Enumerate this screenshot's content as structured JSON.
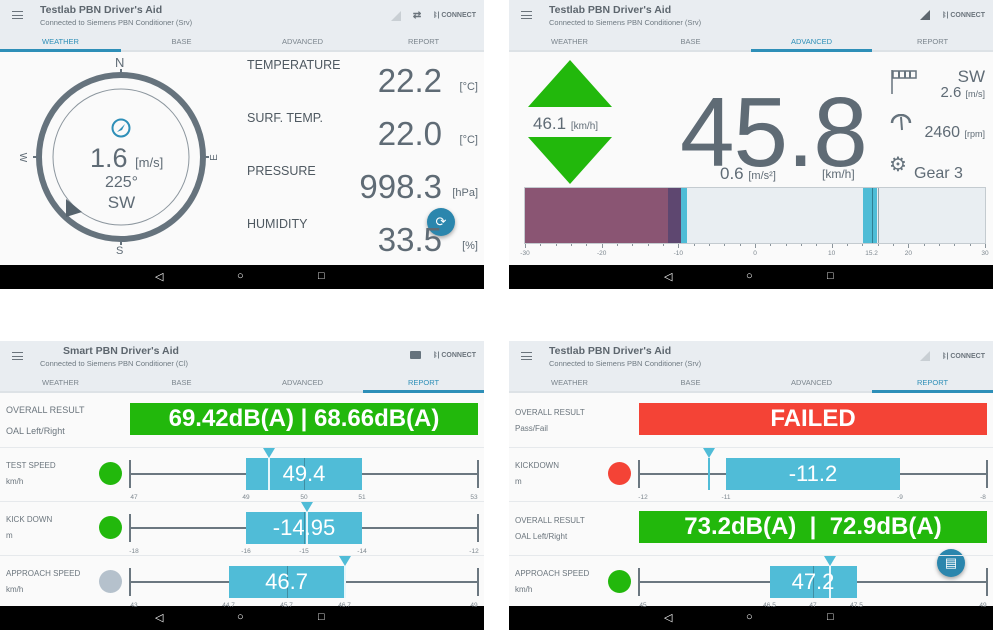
{
  "colors": {
    "accent": "#2e8fb8",
    "green": "#22b80c",
    "red": "#f44336",
    "cyan": "#50bcd7",
    "grey_dot": "#b5c1cc"
  },
  "tabs": [
    "WEATHER",
    "BASE",
    "ADVANCED",
    "REPORT"
  ],
  "connect_label": "CONNECT",
  "panels": [
    {
      "title": "Testlab PBN Driver's Aid",
      "subtitle": "Connected to Siemens PBN Conditioner (Srv)",
      "active_tab": "WEATHER"
    },
    {
      "title": "Testlab PBN Driver's Aid",
      "subtitle": "Connected to Siemens PBN Conditioner (Srv)",
      "active_tab": "ADVANCED"
    },
    {
      "title": "Smart PBN Driver's Aid",
      "subtitle": "Connected to Siemens PBN Conditioner (Cl)",
      "active_tab": "REPORT"
    },
    {
      "title": "Testlab PBN Driver's Aid",
      "subtitle": "Connected to Siemens PBN Conditioner (Srv)",
      "active_tab": "REPORT"
    }
  ],
  "weather": {
    "compass": {
      "n": "N",
      "e": "E",
      "s": "S",
      "w": "W",
      "speed": "1.6",
      "speed_unit": "[m/s]",
      "direction_deg": "225°",
      "direction": "SW"
    },
    "rows": [
      {
        "label": "TEMPERATURE",
        "value": "22.2",
        "unit": "[°C]"
      },
      {
        "label": "SURF. TEMP.",
        "value": "22.0",
        "unit": "[°C]"
      },
      {
        "label": "PRESSURE",
        "value": "998.3",
        "unit": "[hPa]"
      },
      {
        "label": "HUMIDITY",
        "value": "33.5",
        "unit": "[%]"
      }
    ]
  },
  "advanced": {
    "target_speed": "46.1",
    "target_unit": "[km/h]",
    "speed": "45.8",
    "speed_unit": "[km/h]",
    "accel": "0.6",
    "accel_unit": "[m/s²]",
    "wind_dir": "SW",
    "wind_speed": "2.6",
    "wind_unit": "[m/s]",
    "rpm": "2460",
    "rpm_unit": "[rpm]",
    "gear": "Gear 3",
    "bar": {
      "min": -30,
      "max": 30,
      "segments": [
        {
          "from": -30,
          "to": -11.3,
          "color": "#8a5573"
        },
        {
          "from": -11.3,
          "to": -9.6,
          "color": "#5e4770"
        },
        {
          "from": -9.6,
          "to": -8.9,
          "color": "#4fbcd6"
        },
        {
          "from": -8.9,
          "to": 14.1,
          "color": "#e9eef2"
        },
        {
          "from": 14.1,
          "to": 15.9,
          "color": "#4fbcd6"
        },
        {
          "from": 15.9,
          "to": 30,
          "color": "#e9eef2"
        }
      ],
      "marker": 15.2,
      "ticks": [
        "-30",
        "-20",
        "-10",
        "0",
        "10",
        "15.2",
        "20",
        "30"
      ]
    }
  },
  "report_a": {
    "overall": {
      "label": "OVERALL RESULT",
      "sub": "OAL Left/Right",
      "value": "69.42dB(A) | 68.66dB(A)",
      "status": "green"
    },
    "gauges": [
      {
        "label": "TEST SPEED",
        "unit": "km/h",
        "status": "green",
        "min": 47,
        "max": 53,
        "lo": 49,
        "hi": 51,
        "mid": 50,
        "marker": 49.4,
        "value": "49.4",
        "ticks": [
          "47",
          "49",
          "50",
          "51",
          "53"
        ]
      },
      {
        "label": "KICK DOWN",
        "unit": "m",
        "status": "green",
        "min": -18,
        "max": -12,
        "lo": -16,
        "hi": -14,
        "mid": -15,
        "marker": -14.95,
        "value": "-14.95",
        "ticks": [
          "-18",
          "-16",
          "-15",
          "-14",
          "-12"
        ]
      },
      {
        "label": "APPROACH SPEED",
        "unit": "km/h",
        "status": "grey",
        "min": 43,
        "max": 49,
        "lo": 44.7,
        "hi": 46.7,
        "mid": 45.7,
        "marker": 46.7,
        "value": "46.7",
        "ticks": [
          "43",
          "44.7",
          "45.7",
          "46.7",
          "49"
        ]
      }
    ]
  },
  "report_b": {
    "overall": {
      "label": "OVERALL RESULT",
      "sub": "Pass/Fail",
      "value": "FAILED",
      "status": "red"
    },
    "overall2": {
      "label": "OVERALL RESULT",
      "sub": "OAL Left/Right",
      "value": "73.2dB(A)  |  72.9dB(A)",
      "status": "green"
    },
    "gauges": [
      {
        "label": "KICKDOWN",
        "unit": "m",
        "status": "red",
        "min": -12,
        "max": -8,
        "lo": -11,
        "hi": -9,
        "mid": null,
        "marker": -11.2,
        "value": "-11.2",
        "ticks": [
          "-12",
          "-11",
          "-9",
          "-8"
        ]
      },
      {
        "label": "APPROACH SPEED",
        "unit": "km/h",
        "status": "green",
        "min": 45,
        "max": 49,
        "lo": 46.5,
        "hi": 47.5,
        "mid": 47,
        "marker": 47.2,
        "value": "47.2",
        "ticks": [
          "45",
          "46.5",
          "47",
          "47.5",
          "49"
        ]
      }
    ]
  }
}
